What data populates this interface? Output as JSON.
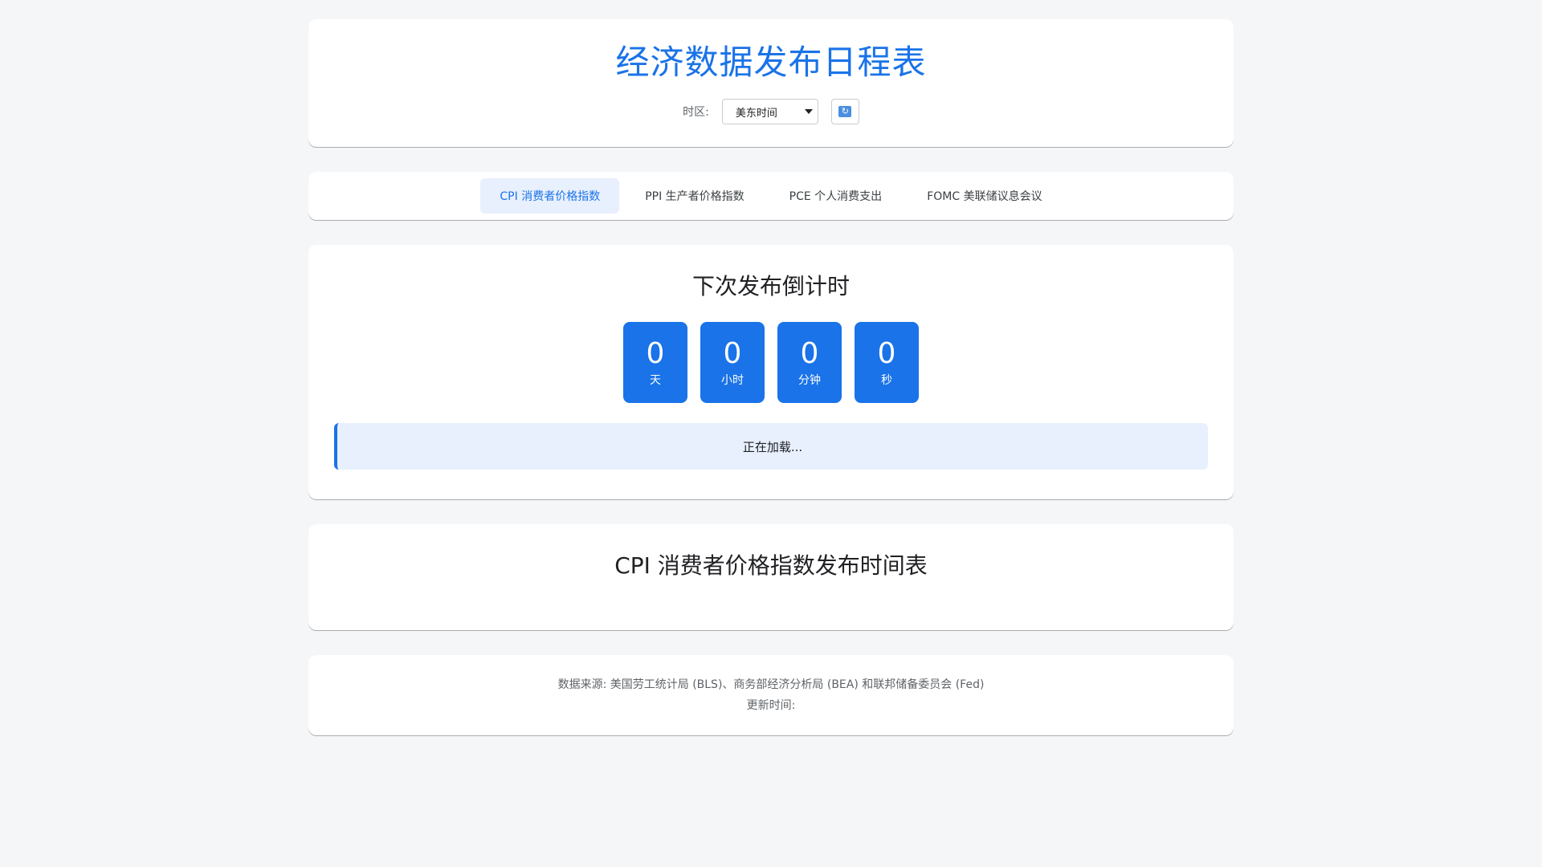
{
  "header": {
    "title": "经济数据发布日程表",
    "timezone_label": "时区:",
    "timezone_selected": "美东时间",
    "refresh_icon": "refresh-icon",
    "refresh_glyph": "🔄"
  },
  "tabs": [
    {
      "label": "CPI 消费者价格指数",
      "active": true
    },
    {
      "label": "PPI 生产者价格指数",
      "active": false
    },
    {
      "label": "PCE 个人消费支出",
      "active": false
    },
    {
      "label": "FOMC 美联储议息会议",
      "active": false
    }
  ],
  "countdown": {
    "title": "下次发布倒计时",
    "days": {
      "value": "0",
      "unit": "天"
    },
    "hours": {
      "value": "0",
      "unit": "小时"
    },
    "minutes": {
      "value": "0",
      "unit": "分钟"
    },
    "seconds": {
      "value": "0",
      "unit": "秒"
    },
    "status": "正在加载..."
  },
  "schedule": {
    "title": "CPI 消费者价格指数发布时间表"
  },
  "footer": {
    "source": "数据来源: 美国劳工统计局 (BLS)、商务部经济分析局 (BEA) 和联邦储备委员会 (Fed)",
    "updated": "更新时间:"
  },
  "colors": {
    "accent": "#1a73e8",
    "tab_active_bg": "#e8f0fe",
    "page_bg": "#f5f6f8"
  }
}
